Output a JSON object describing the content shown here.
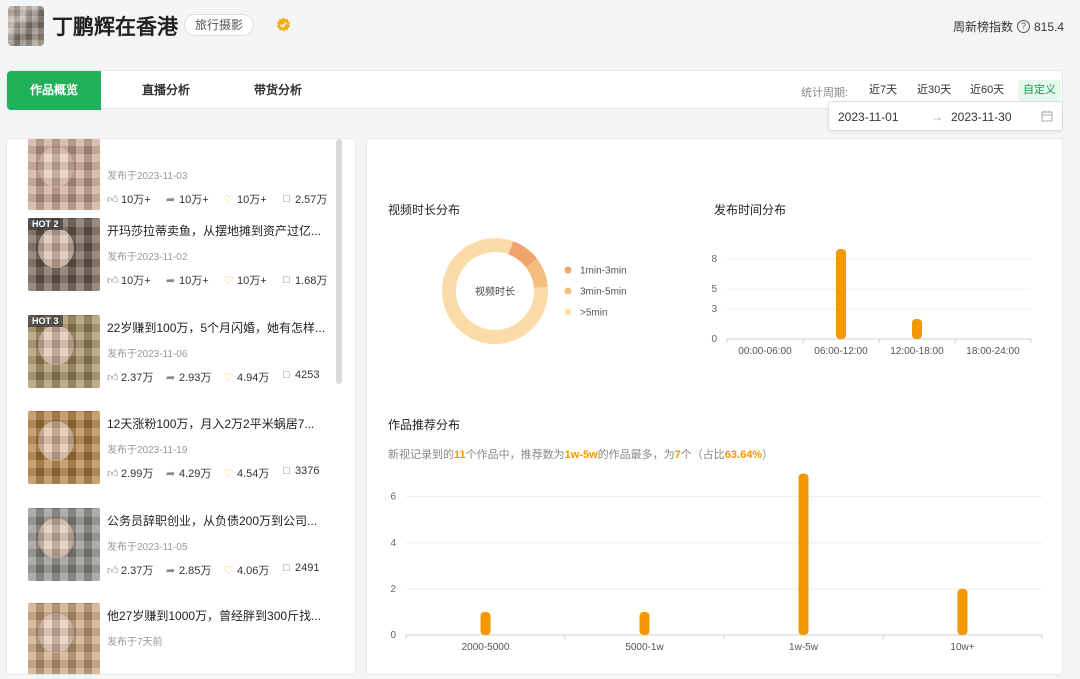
{
  "header": {
    "name": "丁鹏辉在香港",
    "tag": "旅行摄影",
    "index_label": "周新榜指数",
    "index_value": "815.4"
  },
  "tabs": [
    {
      "label": "作品概览",
      "active": true
    },
    {
      "label": "直播分析",
      "active": false
    },
    {
      "label": "带货分析",
      "active": false
    }
  ],
  "period": {
    "label": "统计周期:",
    "options": [
      "近7天",
      "近30天",
      "近60天",
      "自定义"
    ],
    "active": "自定义",
    "start": "2023-11-01",
    "end": "2023-11-30",
    "separator": "→"
  },
  "works": [
    {
      "title": "",
      "hot": "",
      "date": "发布于2023-11-03",
      "likes": "10万+",
      "shares": "10万+",
      "favs": "10万+",
      "comments": "2.57万",
      "thumb_color": "#c9a48c"
    },
    {
      "title": "开玛莎拉蒂卖鱼，从摆地摊到资产过亿...",
      "hot": "HOT 2",
      "date": "发布于2023-11-02",
      "likes": "10万+",
      "shares": "10万+",
      "favs": "10万+",
      "comments": "1.68万",
      "thumb_color": "#6d5a4a"
    },
    {
      "title": "22岁赚到100万，5个月闪婚，她有怎样...",
      "hot": "HOT 3",
      "date": "发布于2023-11-06",
      "likes": "2.37万",
      "shares": "2.93万",
      "favs": "4.94万",
      "comments": "4253",
      "thumb_color": "#a08a5c"
    },
    {
      "title": "12天涨粉100万，月入2万2平米蜗居7...",
      "hot": "",
      "date": "发布于2023-11-19",
      "likes": "2.99万",
      "shares": "4.29万",
      "favs": "4.54万",
      "comments": "3376",
      "thumb_color": "#b07a3a"
    },
    {
      "title": "公务员辞职创业，从负债200万到公司...",
      "hot": "",
      "date": "发布于2023-11-05",
      "likes": "2.37万",
      "shares": "2.85万",
      "favs": "4.06万",
      "comments": "2491",
      "thumb_color": "#8c8a86"
    },
    {
      "title": "他27岁赚到1000万，曾经胖到300斤找...",
      "hot": "",
      "date": "发布于7天前",
      "likes": "",
      "shares": "",
      "favs": "",
      "comments": "",
      "thumb_color": "#c6a07a"
    }
  ],
  "sections": {
    "duration_title": "视频时长分布",
    "publish_title": "发布时间分布",
    "recommend_title": "作品推荐分布"
  },
  "summary": {
    "p1": "新视记录到的",
    "total": "11",
    "p2": "个作品中，推荐数为",
    "range": "1w-5w",
    "p3": "的作品最多，为",
    "count": "7",
    "p4": "个（占比",
    "pct": "63.64%",
    "p5": "）"
  },
  "colors": {
    "accent_green": "#21b15a",
    "bar_orange": "#f39800",
    "donut": [
      "#f0a36a",
      "#f5bd80",
      "#fbdca8"
    ]
  },
  "chart_data": [
    {
      "type": "pie",
      "center_label": "视频时长",
      "labels": [
        "1min-3min",
        "3min-5min",
        ">5min"
      ],
      "values": [
        1,
        1,
        9
      ],
      "colors": [
        "#f0a36a",
        "#f5bd80",
        "#fbdca8"
      ],
      "legend": "right"
    },
    {
      "type": "bar",
      "categories": [
        "00:00-06:00",
        "06:00-12:00",
        "12:00-18:00",
        "18:00-24:00"
      ],
      "values": [
        0,
        9,
        2,
        0
      ],
      "yticks": [
        0,
        3,
        5,
        8
      ],
      "ylim": [
        0,
        10
      ]
    },
    {
      "type": "bar",
      "categories": [
        "2000-5000",
        "5000-1w",
        "1w-5w",
        "10w+"
      ],
      "values": [
        1,
        1,
        7,
        2
      ],
      "yticks": [
        0,
        2,
        4,
        6
      ],
      "ylim": [
        0,
        7.2
      ]
    }
  ]
}
